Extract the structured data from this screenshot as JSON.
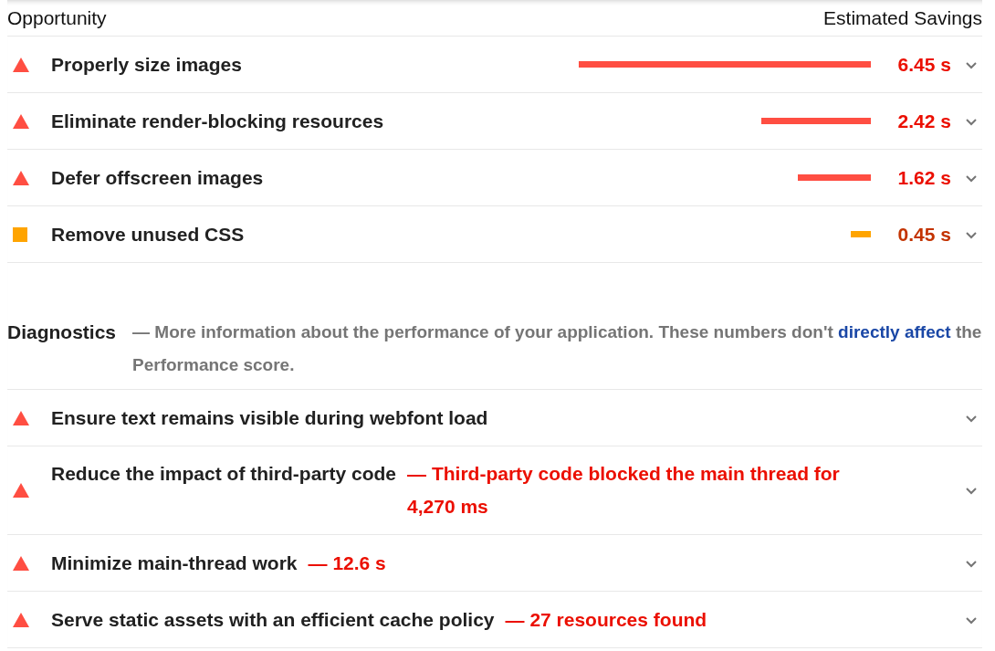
{
  "opportunity": {
    "header": {
      "title": "Opportunity",
      "savings": "Estimated Savings"
    },
    "rows": [
      {
        "kind": "fail",
        "title": "Properly size images",
        "savings": "6.45 s",
        "expanded": false
      },
      {
        "kind": "fail",
        "title": "Eliminate render-blocking resources",
        "savings": "2.42 s",
        "expanded": false
      },
      {
        "kind": "fail",
        "title": "Defer offscreen images",
        "savings": "1.62 s",
        "expanded": false
      },
      {
        "kind": "average",
        "title": "Remove unused CSS",
        "savings": "0.45 s",
        "expanded": false
      }
    ]
  },
  "diagnostics": {
    "title": "Diagnostics",
    "description_before": "— More information about the performance of your application. These numbers don't",
    "link": "directly affect",
    "description_after": "the Performance score.",
    "rows": [
      {
        "kind": "fail",
        "title": "Ensure text remains visible during webfont load",
        "expanded": false
      },
      {
        "kind": "fail",
        "title": "Reduce the impact of third-party code",
        "detail": "— Third-party code blocked the main thread for 4,270 ms",
        "expanded": false
      },
      {
        "kind": "fail",
        "title": "Minimize main-thread work",
        "detail": "— 12.6 s",
        "expanded": false
      },
      {
        "kind": "fail",
        "title": "Serve static assets with an efficient cache policy",
        "detail": "— 27 resources found",
        "expanded": false
      }
    ]
  }
}
